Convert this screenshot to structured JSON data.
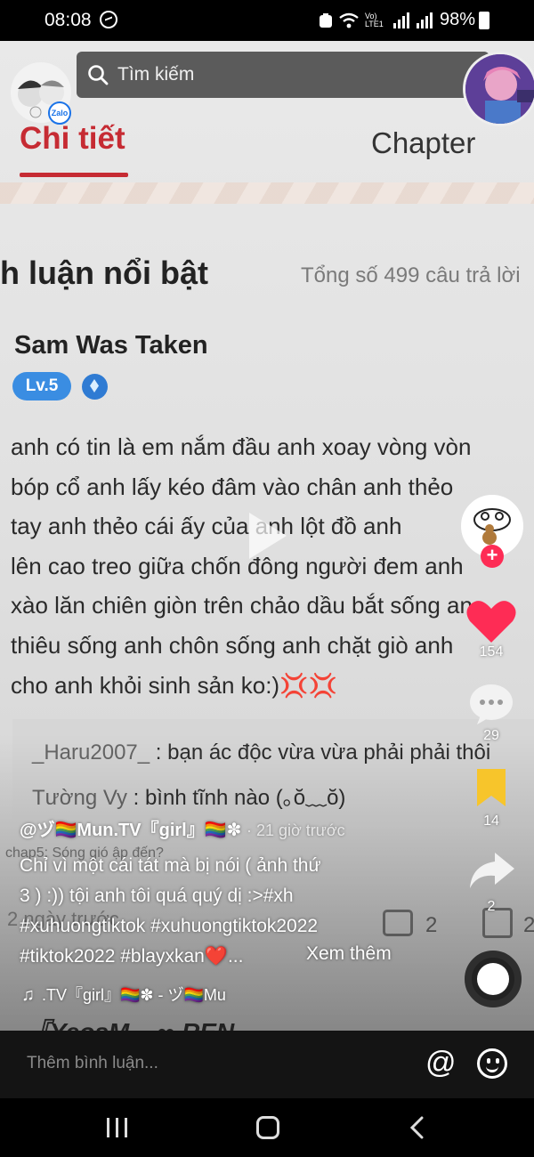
{
  "status_bar": {
    "time": "08:08",
    "network_label": "Vo) LTE1",
    "battery": "98%"
  },
  "search": {
    "placeholder": "Tìm kiếm",
    "zalo_badge": "Zalo"
  },
  "video_content": {
    "tab_detail": "Chi tiết",
    "tab_chapter": "Chapter",
    "section_title": "h luận nổi bật",
    "total_replies": "Tổng số 499 câu trả lời",
    "commenter_name": "Sam Was Taken",
    "commenter_level": "Lv.5",
    "comment_lines": [
      "anh có tin là em nắm đầu anh xoay vòng vòn",
      "bóp cổ anh lấy kéo đâm vào chân anh thẻo",
      "tay anh thẻo cái ấy của anh lột đồ anh",
      "lên cao treo giữa chốn đông người đem anh",
      "xào lăn chiên giòn trên chảo dầu bắt sống an",
      "thiêu sống anh chôn sống anh chặt giò anh",
      "cho anh khỏi sinh sản ko:)"
    ],
    "comment_emoji": "💢💢",
    "replies": [
      {
        "name": "_Haru2007_",
        "text": ": bạn ác độc vừa vừa phải phải thôi"
      },
      {
        "name": "Tường Vy",
        "text": ": bình tĩnh nào (｡ŏ﹏ŏ)"
      }
    ],
    "background_chapter": "chap5: Sóng gió ập đến?",
    "background_time": "2 ngày trước",
    "background_comment_count": "2",
    "background_like_count": "2",
    "background_bottom_name": "『YeosM... ∞ REN"
  },
  "actions": {
    "likes": "154",
    "comments": "29",
    "saves": "14",
    "shares": "2",
    "follow_plus": "+"
  },
  "post": {
    "author": "@ヅ🏳️‍🌈Mun.TV『girl』🏳️‍🌈✽",
    "posted_time": "· 21 giờ trước",
    "caption_lines": [
      "Chỉ vì một cái tát mà bị nói ( ảnh thứ",
      "3 ) :)) tội anh tôi quá quý dị :>#xh",
      "#xuhuongtiktok #xuhuongtiktok2022",
      "#tiktok2022 #blayxkan❤️..."
    ],
    "see_more": "Xem thêm",
    "music": ".TV『girl』🏳️‍🌈✽ - ヅ🏳️‍🌈Mu"
  },
  "comment_bar": {
    "placeholder": "Thêm bình luận..."
  },
  "colors": {
    "accent_red": "#c62b33",
    "like_red": "#fe2c55",
    "save_yellow": "#f7c52b",
    "level_blue": "#3a8de2"
  }
}
